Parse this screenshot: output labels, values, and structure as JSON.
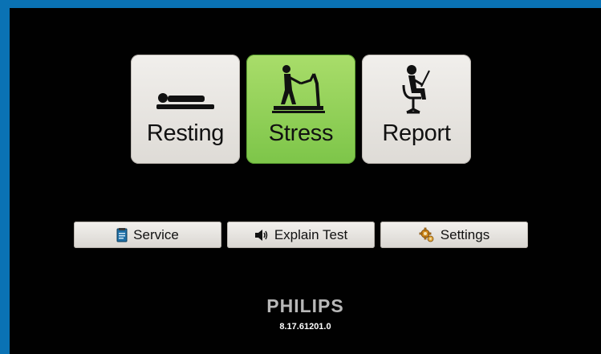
{
  "main_buttons": [
    {
      "label": "Resting",
      "icon": "lying-person-icon"
    },
    {
      "label": "Stress",
      "icon": "treadmill-icon",
      "selected": true
    },
    {
      "label": "Report",
      "icon": "seated-person-icon"
    }
  ],
  "secondary_buttons": [
    {
      "label": "Service",
      "icon": "service-manual-icon"
    },
    {
      "label": "Explain Test",
      "icon": "speaker-icon"
    },
    {
      "label": "Settings",
      "icon": "settings-gear-icon"
    }
  ],
  "brand": "PHILIPS",
  "version": "8.17.61201.0",
  "colors": {
    "frame": "#0a72b4",
    "background": "#010101",
    "selected_button": "#8fd055",
    "button": "#e9e6e2",
    "brand_text": "#b8b8b8"
  }
}
